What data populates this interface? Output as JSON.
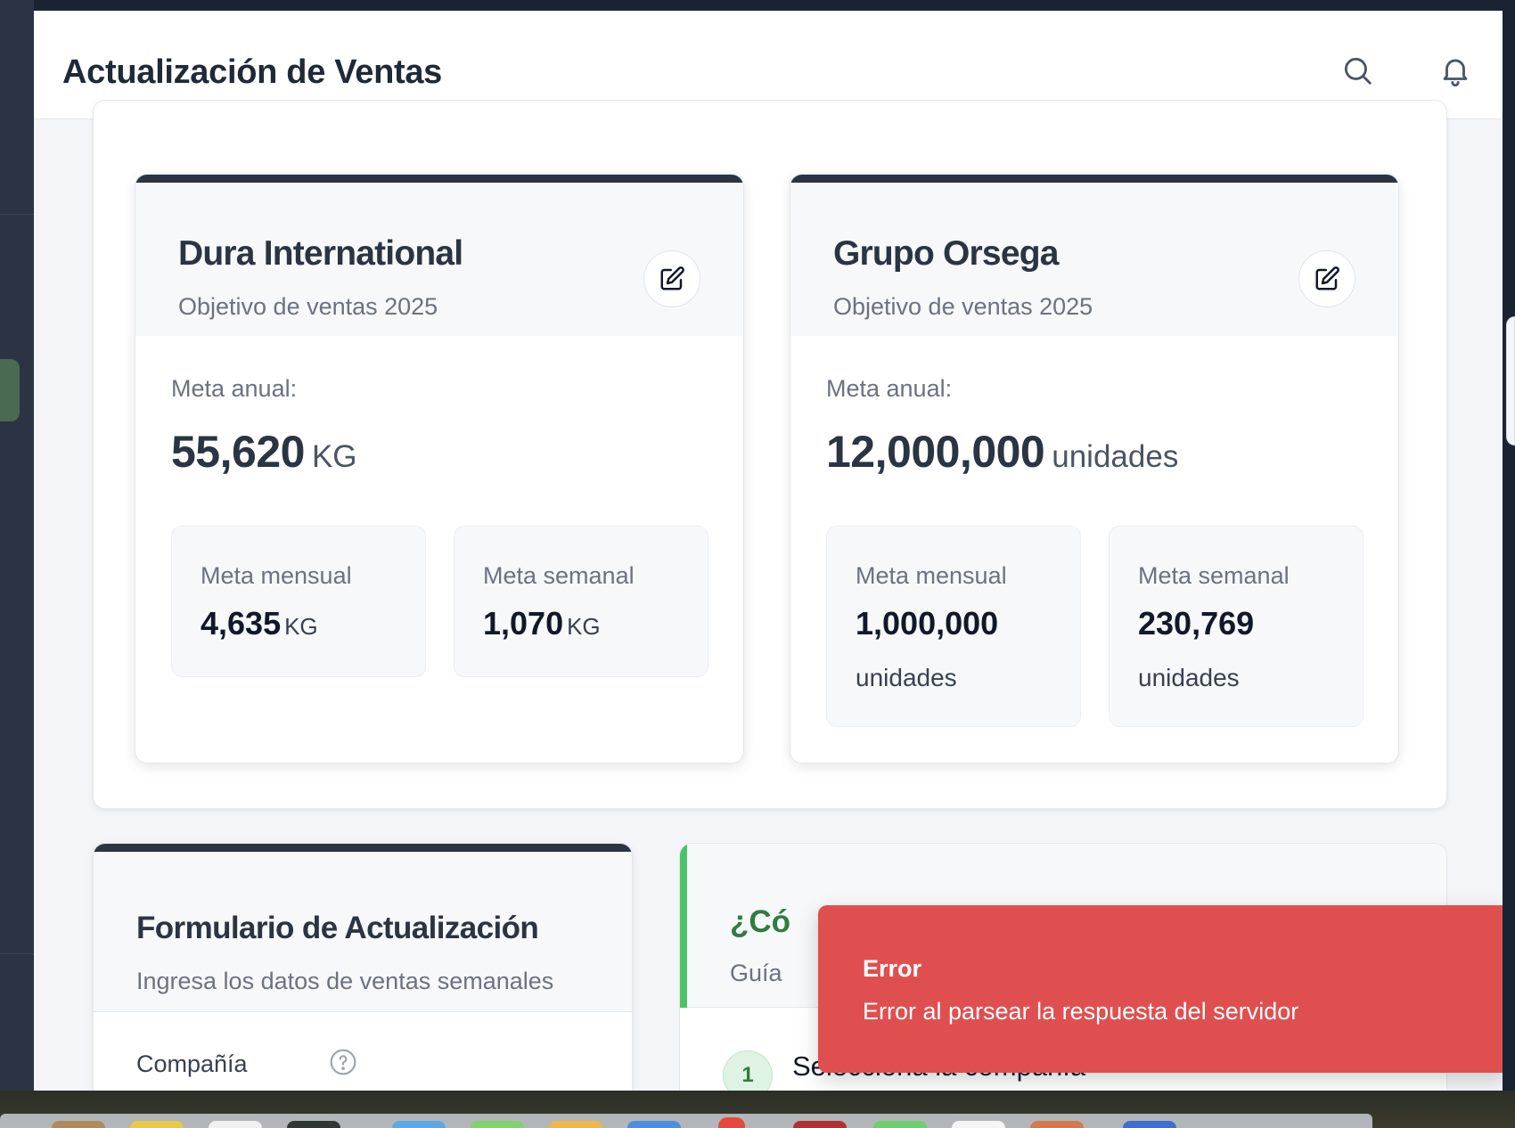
{
  "header": {
    "title": "Actualización de Ventas",
    "search_icon": "search-icon",
    "bell_icon": "bell-icon"
  },
  "goals": {
    "cards": [
      {
        "company": "Dura International",
        "subtitle": "Objetivo de ventas 2025",
        "annual_label": "Meta anual:",
        "annual_value": "55,620",
        "annual_unit": "KG",
        "monthly_label": "Meta mensual",
        "monthly_value": "4,635",
        "monthly_unit": "KG",
        "weekly_label": "Meta semanal",
        "weekly_value": "1,070",
        "weekly_unit": "KG"
      },
      {
        "company": "Grupo Orsega",
        "subtitle": "Objetivo de ventas 2025",
        "annual_label": "Meta anual:",
        "annual_value": "12,000,000",
        "annual_unit": "unidades",
        "monthly_label": "Meta mensual",
        "monthly_value": "1,000,000",
        "monthly_unit": "unidades",
        "weekly_label": "Meta semanal",
        "weekly_value": "230,769",
        "weekly_unit": "unidades"
      }
    ]
  },
  "form": {
    "title": "Formulario de Actualización",
    "description": "Ingresa los datos de ventas semanales",
    "company_label": "Compañía"
  },
  "guide": {
    "title": "¿Có",
    "description": "Guía",
    "step1_number": "1",
    "step1_text": "Selecciona la compañía"
  },
  "toast": {
    "title": "Error",
    "message": "Error al parsear la respuesta del servidor"
  },
  "colors": {
    "header_dark": "#2b3442",
    "accent_green": "#4cc36a",
    "toast_red": "#e04f4f"
  }
}
